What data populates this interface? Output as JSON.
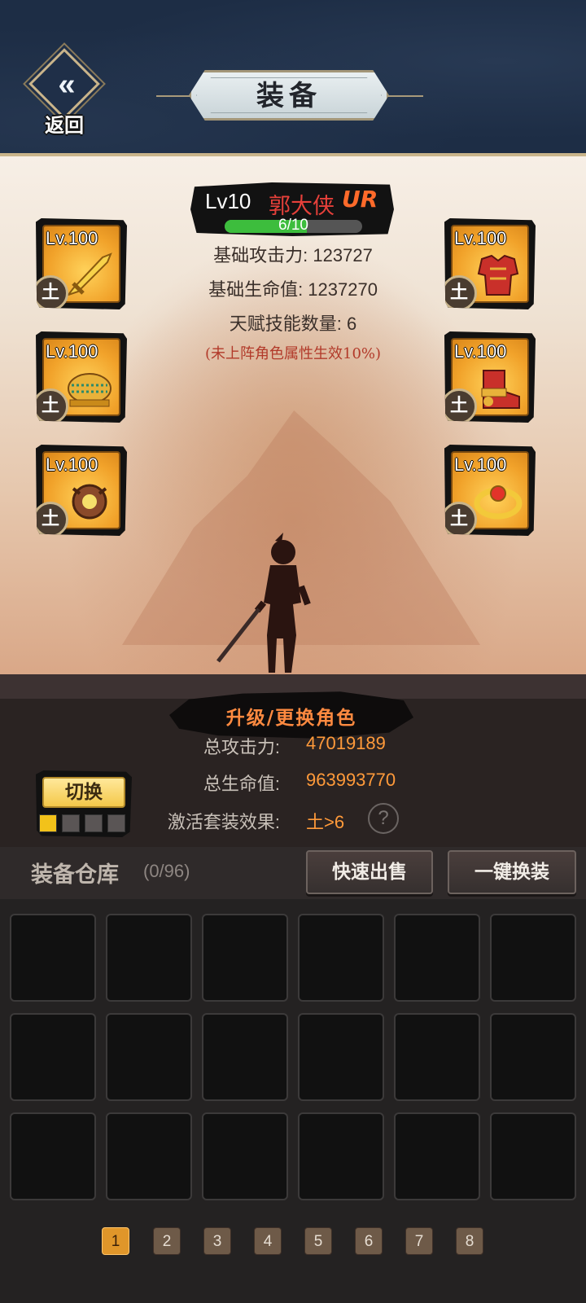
{
  "header": {
    "back_label": "返回",
    "title": "装备"
  },
  "hero": {
    "level": "Lv10",
    "name": "郭大侠",
    "rarity": "UR",
    "xp_text": "6/10",
    "xp_progress": 0.6,
    "stats": {
      "base_attack": "基础攻击力: 123727",
      "base_hp": "基础生命值: 1237270",
      "talent_count": "天赋技能数量: 6",
      "note": "(未上阵角色属性生效10%)"
    }
  },
  "equipment": {
    "slots": [
      {
        "level": "Lv.100",
        "element": "土",
        "item": "sword-icon"
      },
      {
        "level": "Lv.100",
        "element": "土",
        "item": "helmet-icon"
      },
      {
        "level": "Lv.100",
        "element": "土",
        "item": "amulet-icon"
      },
      {
        "level": "Lv.100",
        "element": "土",
        "item": "armor-icon"
      },
      {
        "level": "Lv.100",
        "element": "土",
        "item": "boots-icon"
      },
      {
        "level": "Lv.100",
        "element": "土",
        "item": "ring-icon"
      }
    ]
  },
  "upgrade_button": "升级/更换角色",
  "summary": {
    "total_attack_label": "总攻击力:",
    "total_attack_value": "47019189",
    "total_hp_label": "总生命值:",
    "total_hp_value": "963993770",
    "set_label": "激活套装效果:",
    "set_value": "土>6",
    "help": "?"
  },
  "switch": {
    "label": "切换",
    "active_set": 1,
    "set_count": 4
  },
  "warehouse": {
    "title": "装备仓库",
    "count": "(0/96)",
    "quick_sell": "快速出售",
    "equip_all": "一键换装"
  },
  "pagination": {
    "pages": [
      "1",
      "2",
      "3",
      "4",
      "5",
      "6",
      "7",
      "8"
    ],
    "current": "1"
  },
  "colors": {
    "header_bg": "#1d2d45",
    "accent_gold": "#c9b48a",
    "value_orange": "#ff9a3a",
    "name_red": "#e6403a",
    "xp_green": "#3dbd3d"
  }
}
